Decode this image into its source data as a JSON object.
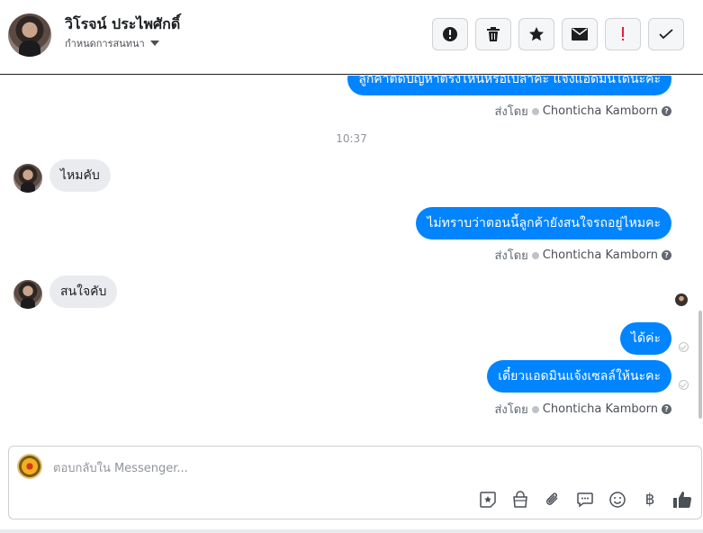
{
  "header": {
    "contact_name": "วิโรจน์ ประไพศักดิ์",
    "conversation_settings_label": "กำหนดการสนทนา",
    "actions": [
      {
        "name": "report-icon",
        "label": "Report"
      },
      {
        "name": "trash-icon",
        "label": "Delete"
      },
      {
        "name": "star-icon",
        "label": "Star"
      },
      {
        "name": "envelope-icon",
        "label": "Mark unread"
      },
      {
        "name": "exclamation-icon",
        "label": "Mark important"
      },
      {
        "name": "check-icon",
        "label": "Done"
      }
    ]
  },
  "thread": {
    "messages": [
      {
        "from": "page",
        "text": "ลูกค้าติดปัญหาตรงไหนหรือเปล่าคะ แจ้งแอดมินได้นะคะ"
      },
      {
        "type": "time",
        "text": "10:37"
      },
      {
        "from": "customer",
        "text": "ไหมคับ"
      },
      {
        "from": "page",
        "text": "ไม่ทราบว่าตอนนี้ลูกค้ายังสนใจรถอยู่ไหมคะ"
      },
      {
        "from": "customer",
        "text": "สนใจคับ"
      },
      {
        "from": "page",
        "text": "ได้ค่ะ"
      },
      {
        "from": "page",
        "text": "เดี๋ยวแอดมินแจ้งเซลล์ให้นะคะ"
      }
    ],
    "sent_by_prefix": "ส่งโดย",
    "agent_name": "Chonticha Kamborn",
    "help_glyph": "?"
  },
  "composer": {
    "placeholder": "ตอบกลับใน Messenger...",
    "value": "",
    "tools": [
      "sticker-icon",
      "shop-icon",
      "attach-icon",
      "saved-reply-icon",
      "emoji-icon",
      "payment-icon",
      "like-icon"
    ],
    "currency_glyph": "฿"
  },
  "colors": {
    "outgoing": "#0084ff",
    "incoming": "#e9ebee",
    "meta_text": "#606770",
    "alert_red": "#e41e3f"
  }
}
